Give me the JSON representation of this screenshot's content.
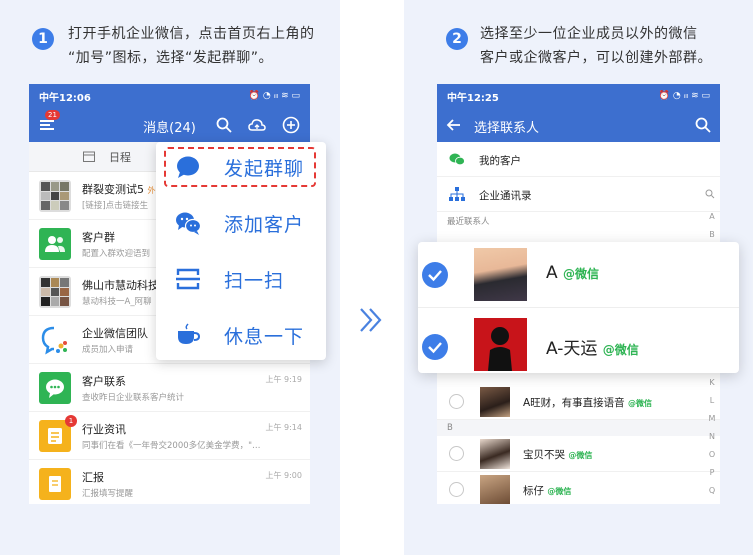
{
  "step1": {
    "num": "1",
    "line1": "打开手机企业微信，点击首页右上角的",
    "line2": "“加号”图标，选择“发起群聊”。"
  },
  "step2": {
    "num": "2",
    "line1": "选择至少一位企业成员以外的微信",
    "line2": "客户或企微客户，可以创建外部群。"
  },
  "left_phone": {
    "time": "中午12:06",
    "status_icons": "⏰ ◔ ᵢₗₗ ≋ ▭",
    "badge": "21",
    "title": "消息(24)",
    "schedule": "日程",
    "chats": [
      {
        "title": "群裂变测试5",
        "title_suffix": "外",
        "sub": "[链接]点击链接生",
        "time": ""
      },
      {
        "title": "客户群",
        "sub": "配置入群欢迎语到",
        "time": ""
      },
      {
        "title": "佛山市慧动科技",
        "sub": "慧动科技一A_阿聊",
        "time": ""
      },
      {
        "title": "企业微信团队",
        "sub": "成员加入申请",
        "time": ""
      },
      {
        "title": "客户联系",
        "sub": "查收昨日企业联系客户统计",
        "time": "上午 9:19"
      },
      {
        "title": "行业资讯",
        "sub": "同事们在看《一年骨交2000多亿美金学费，\"…",
        "time": "上午 9:14",
        "badge": "1"
      },
      {
        "title": "汇报",
        "sub": "汇报填写提醒",
        "time": "上午 9:00"
      }
    ]
  },
  "popup": {
    "items": [
      {
        "label": "发起群聊",
        "icon": "chat-bubble-icon"
      },
      {
        "label": "添加客户",
        "icon": "add-customer-icon"
      },
      {
        "label": "扫一扫",
        "icon": "scan-icon"
      },
      {
        "label": "休息一下",
        "icon": "coffee-cup-icon"
      }
    ]
  },
  "right_phone": {
    "time": "中午12:25",
    "status_icons": "⏰ ◔ ᵢₗₗ ≋ ▭",
    "title": "选择联系人",
    "my_customers": "我的客户",
    "directory": "企业通讯录",
    "recent": "最近联系人",
    "contacts": [
      {
        "name": "A旺财，有事直接语音",
        "tag": "@微信"
      },
      {
        "name": "宝贝不哭",
        "tag": "@微信"
      },
      {
        "name": "标仔",
        "tag": "@微信"
      }
    ],
    "section_b": "B",
    "alpha_top": [
      "A",
      "B"
    ],
    "alpha_bottom": [
      "K",
      "L",
      "M",
      "N",
      "O",
      "P",
      "Q",
      "R"
    ]
  },
  "card": {
    "items": [
      {
        "name": "A",
        "tag": "@微信"
      },
      {
        "name": "A-天运",
        "tag": "@微信"
      }
    ]
  },
  "colors": {
    "accent": "#3d7de8",
    "topbar": "#3d6fcf",
    "wechat_green": "#2fb454",
    "highlight_red": "#e53935"
  }
}
